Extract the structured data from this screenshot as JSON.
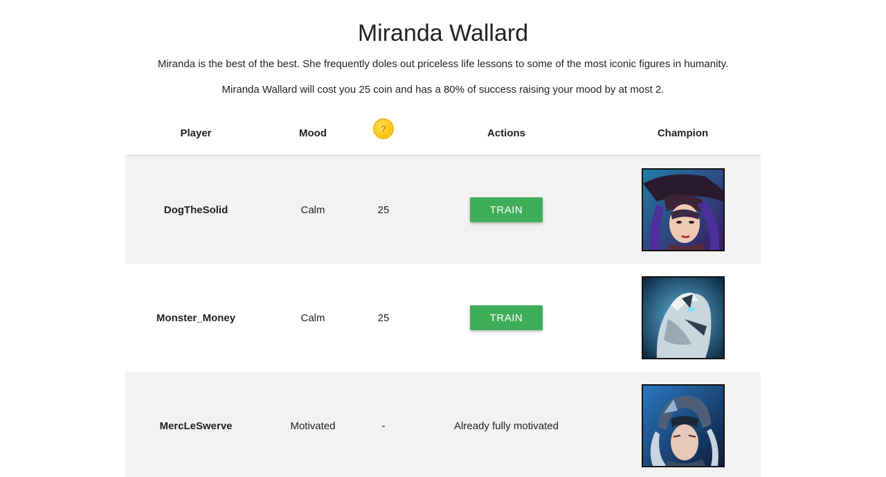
{
  "header": {
    "title": "Miranda Wallard",
    "description": "Miranda is the best of the best. She frequently doles out priceless life lessons to some of the most iconic figures in humanity.",
    "cost_line": "Miranda Wallard will cost you 25 coin and has a 80% of success raising your mood by at most 2."
  },
  "table": {
    "columns": {
      "player": "Player",
      "mood": "Mood",
      "coin_icon": "coin-icon",
      "actions": "Actions",
      "champion": "Champion"
    },
    "rows": [
      {
        "player": "DogTheSolid",
        "mood": "Calm",
        "cost": "25",
        "action_label": "TRAIN",
        "champion_portrait": "hatted-sharpshooter-portrait-icon"
      },
      {
        "player": "Monster_Money",
        "mood": "Calm",
        "cost": "25",
        "action_label": "TRAIN",
        "champion_portrait": "wolf-portrait-icon"
      },
      {
        "player": "MercLeSwerve",
        "mood": "Motivated",
        "cost": "-",
        "action_text": "Already fully motivated",
        "champion_portrait": "helmeted-warrior-portrait-icon"
      }
    ]
  },
  "colors": {
    "train_button": "#3fae5a",
    "row_alt_bg": "#f2f2f2",
    "coin": "#ffc91a"
  }
}
